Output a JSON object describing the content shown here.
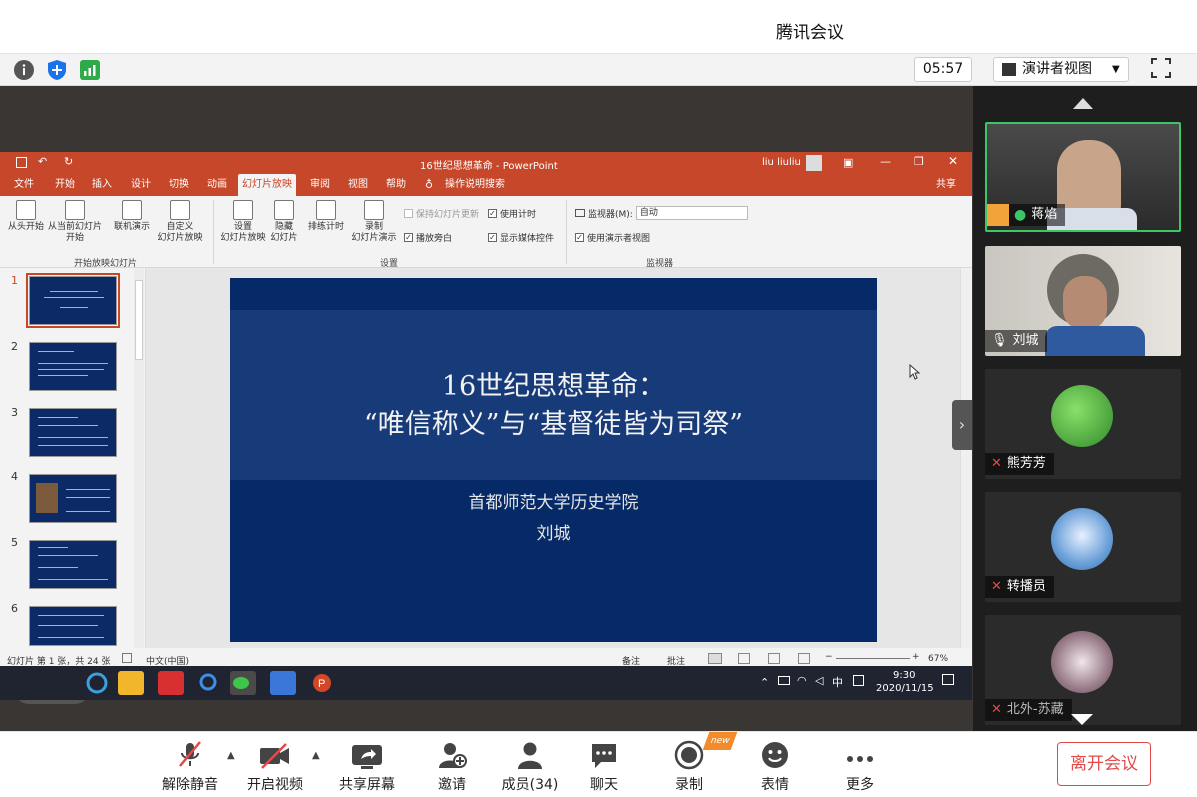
{
  "app": {
    "title": "腾讯会议"
  },
  "toolbar": {
    "timer": "05:57",
    "view_label": "演讲者视图"
  },
  "ppt": {
    "window_title": "16世纪思想革命 - PowerPoint",
    "user": "liu liuliu",
    "share_label": "共享",
    "tabs": [
      "文件",
      "开始",
      "插入",
      "设计",
      "切换",
      "动画",
      "幻灯片放映",
      "审阅",
      "视图",
      "帮助",
      "操作说明搜索"
    ],
    "ribbon": {
      "from_start": "从头开始",
      "from_current_1": "从当前幻灯片",
      "from_current_2": "开始",
      "online_1": "联机演示",
      "custom_1": "自定义",
      "custom_2": "幻灯片放映",
      "group1": "开始放映幻灯片",
      "setup_1": "设置",
      "setup_2": "幻灯片放映",
      "hide_1": "隐藏",
      "hide_2": "幻灯片",
      "rehearse": "排练计时",
      "record_1": "录制",
      "record_2": "幻灯片演示",
      "keep_updated": "保持幻灯片更新",
      "use_timings": "使用计时",
      "play_narration": "播放旁白",
      "show_media": "显示媒体控件",
      "group2": "设置",
      "monitor_label": "监视器(M):",
      "monitor_value": "自动",
      "presenter_view": "使用演示者视图",
      "group3": "监视器"
    },
    "thumbnails": [
      "1",
      "2",
      "3",
      "4",
      "5",
      "6"
    ],
    "slide": {
      "title_line1": "16世纪思想革命：",
      "title_line2": "“唯信称义”与“基督徒皆为司祭”",
      "subtitle_line1": "首都师范大学历史学院",
      "subtitle_line2": "刘城"
    },
    "status": {
      "slide_info": "幻灯片 第 1 张，共 24 张",
      "language": "中文(中国)",
      "notes": "备注",
      "comments": "批注",
      "zoom": "67%"
    }
  },
  "taskbar": {
    "time": "9:30",
    "date": "2020/11/15",
    "ime": "中"
  },
  "participants": [
    {
      "name": "蒋焰",
      "muted": false,
      "host": true,
      "type": "video"
    },
    {
      "name": "刘城",
      "muted": false,
      "host": false,
      "type": "video"
    },
    {
      "name": "熊芳芳",
      "muted": true,
      "host": false,
      "type": "avatar"
    },
    {
      "name": "转播员",
      "muted": true,
      "host": false,
      "type": "avatar"
    },
    {
      "name": "北外-苏藏",
      "muted": true,
      "host": false,
      "type": "avatar"
    }
  ],
  "bottombar": {
    "unmute": "解除静音",
    "video": "开启视频",
    "share": "共享屏幕",
    "invite": "邀请",
    "members": "成员(34)",
    "chat": "聊天",
    "record": "录制",
    "new_badge": "new",
    "reactions": "表情",
    "more": "更多",
    "leave": "离开会议"
  },
  "colors": {
    "ppt_accent": "#c64729",
    "slide_bg": "#062a67",
    "active_speaker": "#3cc766",
    "leave": "#e24a4a"
  }
}
